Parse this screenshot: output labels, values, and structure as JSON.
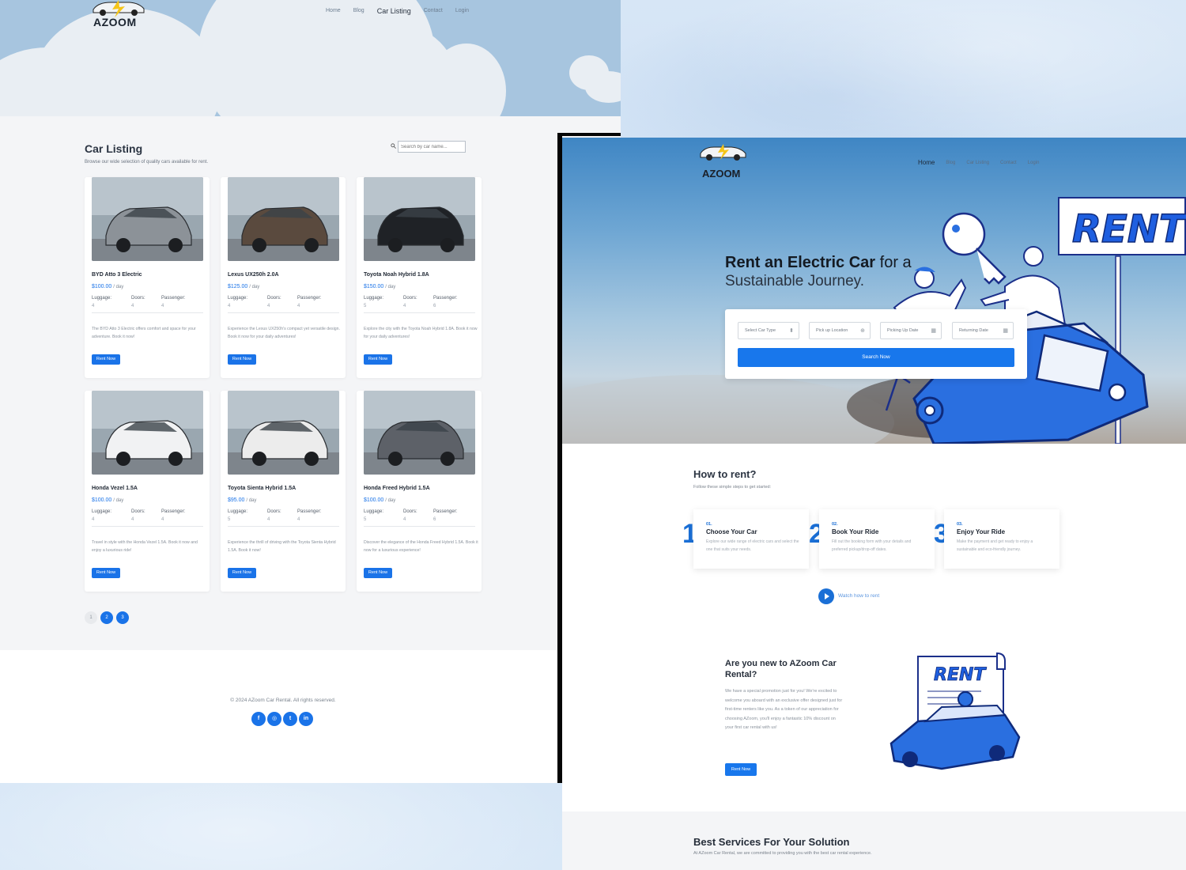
{
  "listing_page": {
    "logo_text": "AZOOM",
    "nav": [
      "Home",
      "Blog",
      "Car Listing",
      "Contact",
      "Login"
    ],
    "nav_active": "Car Listing",
    "title": "Car Listing",
    "subtitle": "Browse our wide selection of quality cars available for rent.",
    "search_placeholder": "Search by car name...",
    "spec_labels": {
      "luggage": "Luggage:",
      "doors": "Doors:",
      "passenger": "Passenger:"
    },
    "price_unit": "/ day",
    "rent_button": "Rent Now",
    "cars": [
      {
        "name": "BYD Atto 3 Electric",
        "price": "$100.00",
        "luggage": "4",
        "doors": "4",
        "passenger": "4",
        "desc": "The BYD Atto 3 Electric offers comfort and space for your adventure. Book it now!",
        "color": "#8c9298"
      },
      {
        "name": "Lexus UX250h 2.0A",
        "price": "$125.00",
        "luggage": "4",
        "doors": "4",
        "passenger": "4",
        "desc": "Experience the Lexus UX250h's compact yet versatile design. Book it now for your daily adventures!",
        "color": "#5a4a3e"
      },
      {
        "name": "Toyota Noah Hybrid 1.8A",
        "price": "$150.00",
        "luggage": "5",
        "doors": "4",
        "passenger": "6",
        "desc": "Explore the city with the Toyota Noah Hybrid 1.8A. Book it now for your daily adventures!",
        "color": "#1f2226"
      },
      {
        "name": "Honda Vezel 1.5A",
        "price": "$100.00",
        "luggage": "4",
        "doors": "4",
        "passenger": "4",
        "desc": "Travel in style with the Honda Vezel 1.5A. Book it now and enjoy a luxurious ride!",
        "color": "#f1f2f3"
      },
      {
        "name": "Toyota Sienta Hybrid 1.5A",
        "price": "$95.00",
        "luggage": "5",
        "doors": "4",
        "passenger": "4",
        "desc": "Experience the thrill of driving with the Toyota Sienta Hybrid 1.5A. Book it now!",
        "color": "#ececec"
      },
      {
        "name": "Honda Freed Hybrid 1.5A",
        "price": "$100.00",
        "luggage": "5",
        "doors": "4",
        "passenger": "6",
        "desc": "Discover the elegance of the Honda Freed Hybrid 1.5A. Book it now for a luxurious experience!",
        "color": "#5d6168"
      }
    ],
    "pagination": [
      "1",
      "2",
      "3"
    ],
    "current_page": "1",
    "copyright": "© 2024 AZoom Car Rental. All rights reserved.",
    "socials": [
      {
        "name": "facebook-icon",
        "glyph": "f"
      },
      {
        "name": "instagram-icon",
        "glyph": "◎"
      },
      {
        "name": "twitter-icon",
        "glyph": "t"
      },
      {
        "name": "linkedin-icon",
        "glyph": "in"
      }
    ]
  },
  "home_page": {
    "logo_text": "AZOOM",
    "nav": [
      "Home",
      "Blog",
      "Car Listing",
      "Contact",
      "Login"
    ],
    "nav_active": "Home",
    "hero_title_bold": "Rent an Electric Car",
    "hero_title_light": "for a",
    "hero_title_line2": "Sustainable Journey.",
    "rent_sign": "RENT",
    "search": {
      "car_type": "Select Car Type",
      "pickup_location": "Pick up Location",
      "pickup_date": "Picking Up Date",
      "return_date": "Returning Date",
      "button": "Search Now"
    },
    "how_title": "How to rent?",
    "how_sub": "Follow these simple steps to get started:",
    "steps": [
      {
        "big": "1",
        "num": "01.",
        "title": "Choose Your Car",
        "desc": "Explore our wide range of electric cars and select the one that suits your needs."
      },
      {
        "big": "2",
        "num": "02.",
        "title": "Book Your Ride",
        "desc": "Fill out the booking form with your details and preferred pickup/drop-off dates."
      },
      {
        "big": "3",
        "num": "03.",
        "title": "Enjoy Your Ride",
        "desc": "Make the payment and get ready to enjoy a sustainable and eco-friendly journey."
      }
    ],
    "watch_label": "Watch how to rent",
    "new_title": "Are you new to AZoom Car Rental?",
    "new_body": "We have a special promotion just for you! We're excited to welcome you aboard with an exclusive offer designed just for first-time renters like you. As a token of our appreciation for choosing AZoom, you'll enjoy a fantastic 10% discount on your first car rental with us!",
    "new_button": "Rent Now",
    "document_sign": "RENT",
    "services_title": "Best Services For Your Solution",
    "services_sub": "At AZoom Car Rental, we are committed to providing you with the best car rental experience."
  },
  "colors": {
    "accent": "#1a73e8",
    "hero_sky": "#a7c5df",
    "page_bg": "#f4f5f7"
  }
}
